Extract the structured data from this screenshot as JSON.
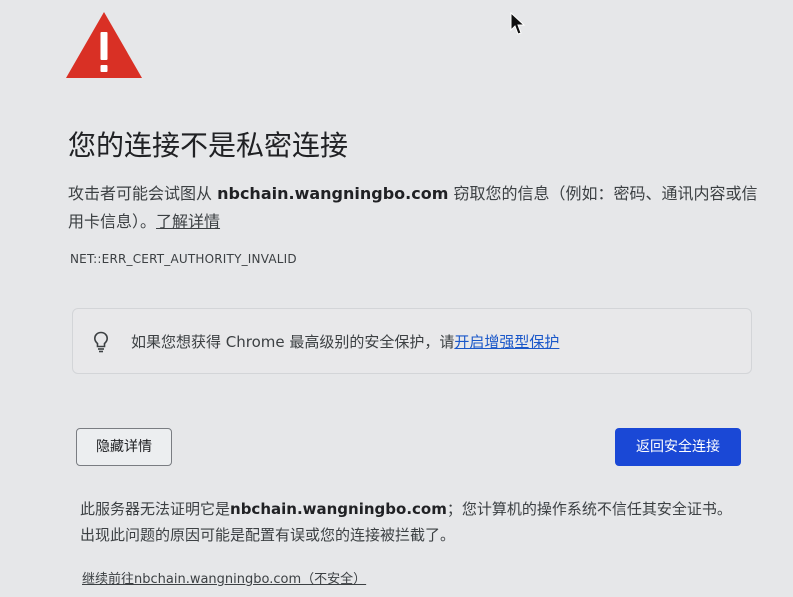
{
  "title": "您的连接不是私密连接",
  "description": {
    "before_host": "攻击者可能会试图从 ",
    "host": "nbchain.wangningbo.com",
    "after_host": " 窃取您的信息（例如：密码、通讯内容或信用卡信息）。",
    "learn_more": "了解详情"
  },
  "error_code": "NET::ERR_CERT_AUTHORITY_INVALID",
  "tip": {
    "text": "如果您想获得 Chrome 最高级别的安全保护，请",
    "link": "开启增强型保护"
  },
  "buttons": {
    "details": "隐藏详情",
    "back": "返回安全连接"
  },
  "explanation": {
    "before_host": "此服务器无法证明它是",
    "host": "nbchain.wangningbo.com",
    "after_host": "；您计算机的操作系统不信任其安全证书。出现此问题的原因可能是配置有误或您的连接被拦截了。"
  },
  "proceed_link": "继续前往nbchain.wangningbo.com（不安全）",
  "colors": {
    "warning_red": "#d93025",
    "primary_button": "#1a48d6",
    "link_blue": "#1a57c9"
  },
  "icons": {
    "warning": "warning-triangle-icon",
    "tip": "lightbulb-icon",
    "cursor": "mouse-cursor-icon"
  }
}
